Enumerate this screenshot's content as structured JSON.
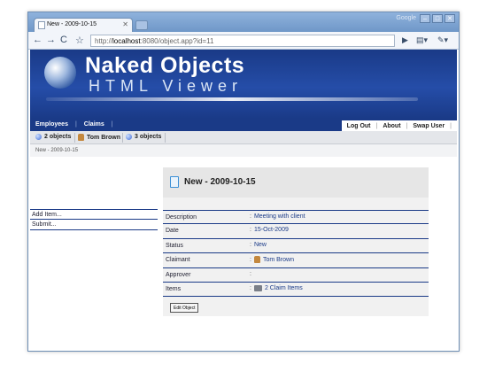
{
  "browser": {
    "tab_title": "New - 2009-10-15",
    "brand": "Google",
    "url_host": "localhost",
    "url_rest": ":8080/object.app?id=11",
    "url_prefix": "http://"
  },
  "app": {
    "logo_title": "Naked Objects",
    "logo_subtitle": "HTML Viewer",
    "menu_left": [
      "Employees",
      "Claims"
    ],
    "menu_right": [
      "Log Out",
      "About",
      "Swap User"
    ]
  },
  "object_bar": [
    {
      "label": "2 objects",
      "icon": "collection-icon"
    },
    {
      "label": "Tom Brown",
      "icon": "person-icon"
    },
    {
      "label": "3 objects",
      "icon": "collection-icon"
    }
  ],
  "breadcrumb": "New - 2009-10-15",
  "actions": [
    "Add Item...",
    "Submit..."
  ],
  "object": {
    "title": "New - 2009-10-15",
    "fields": [
      {
        "label": "Description",
        "value": "Meeting with client"
      },
      {
        "label": "Date",
        "value": "15-Oct-2009"
      },
      {
        "label": "Status",
        "value": "New"
      },
      {
        "label": "Claimant",
        "value": "Tom Brown",
        "icon": "person-icon"
      },
      {
        "label": "Approver",
        "value": ""
      },
      {
        "label": "Items",
        "value": "2 Claim Items",
        "icon": "items-icon"
      }
    ],
    "edit_button": "Edit Object"
  }
}
